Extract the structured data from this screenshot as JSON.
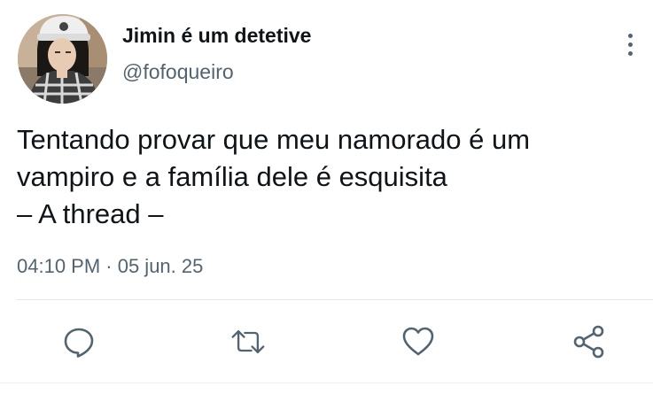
{
  "tweet": {
    "display_name": "Jimin é um detetive",
    "handle": "@fofoqueiro",
    "text_lines": [
      "Tentando provar que meu namorado é um",
      "vampiro e a família dele é esquisita",
      "– A thread –"
    ],
    "timestamp": "04:10 PM · 05 jun. 25"
  },
  "icons": {
    "more": "more-vertical-icon",
    "reply": "reply-icon",
    "retweet": "retweet-icon",
    "like": "heart-icon",
    "share": "share-icon"
  },
  "colors": {
    "text": "#0f1419",
    "secondary": "#536471",
    "divider": "#e1e6ea"
  }
}
